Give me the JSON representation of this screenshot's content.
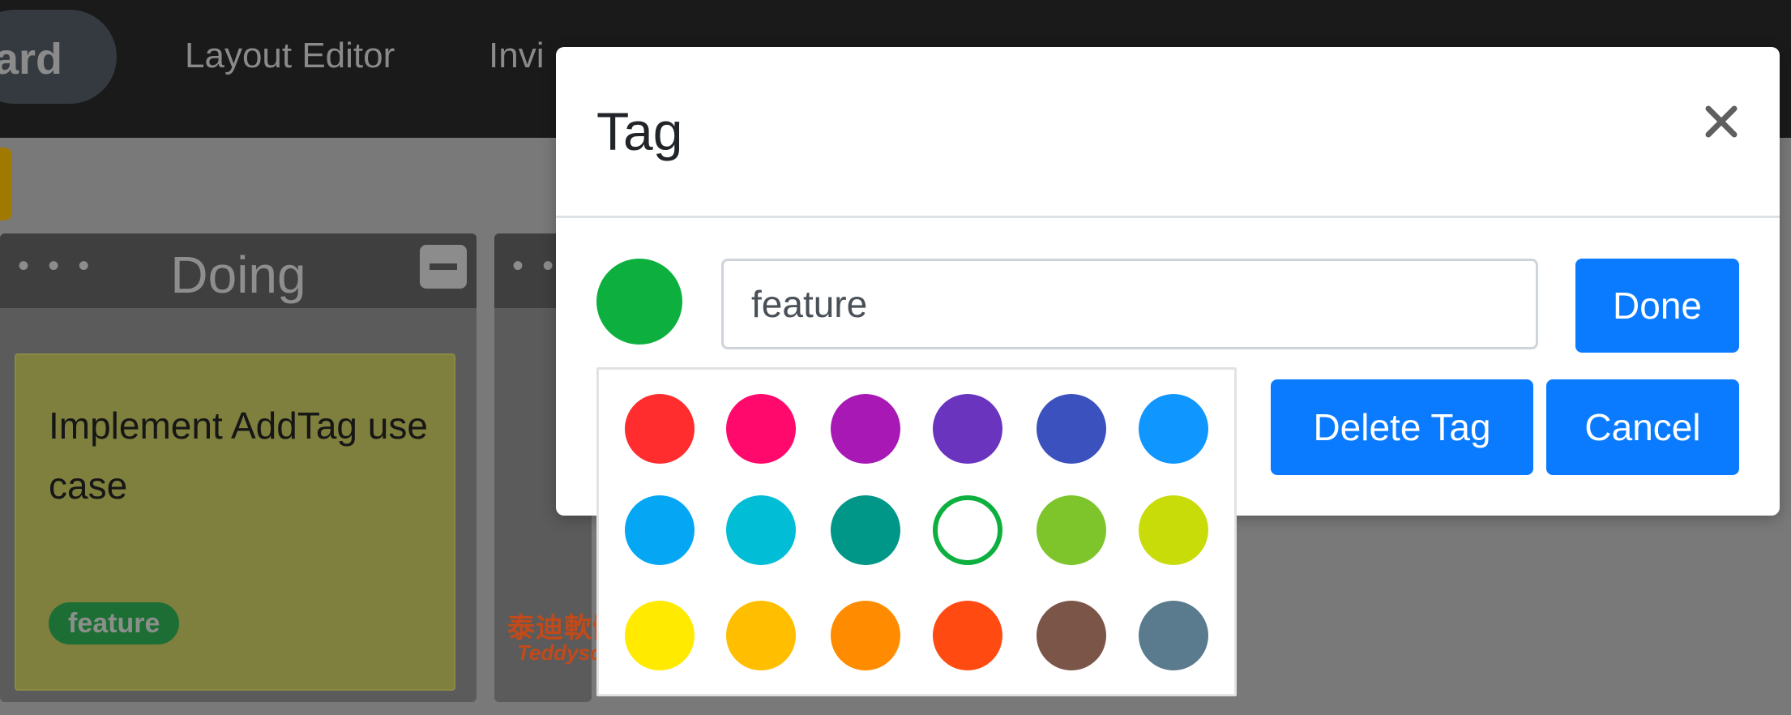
{
  "navbar": {
    "brand": "oard",
    "links": [
      "Layout Editor",
      "Invi"
    ]
  },
  "board": {
    "lane_doing": {
      "handle": "• • •",
      "title": "Doing"
    },
    "lane_next": {
      "handle": "• •"
    },
    "card": {
      "text": "Implement AddTag use case",
      "tag": "feature",
      "tag_color": "#0db03f"
    },
    "watermark": {
      "cn": "泰迪軟體",
      "en": "Teddysoft"
    }
  },
  "modal": {
    "title": "Tag",
    "close_glyph": "×",
    "selected_color": "#0db03f",
    "input_value": "feature",
    "done_label": "Done",
    "delete_label": "Delete Tag",
    "cancel_label": "Cancel"
  },
  "palette": {
    "colors": [
      [
        "#ff2d2d",
        "#ff0a6c",
        "#a818b5",
        "#6a34bf",
        "#3b51bd",
        "#0f96ff"
      ],
      [
        "#05a7f4",
        "#01bdd5",
        "#009688",
        "#0db03f",
        "#7dc52a",
        "#c8dc0a"
      ],
      [
        "#ffea00",
        "#ffbf00",
        "#ff8c00",
        "#ff4b12",
        "#7a5548",
        "#5a7b8d"
      ]
    ],
    "selected": {
      "row": 1,
      "col": 3
    }
  },
  "accent_colors": {
    "primary": "#0a7bff",
    "selected_tag": "#0db03f"
  }
}
